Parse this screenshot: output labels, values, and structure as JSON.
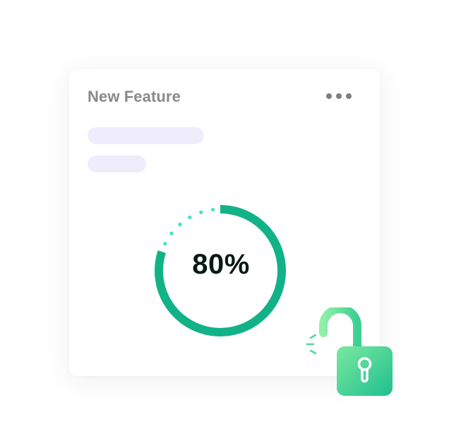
{
  "card": {
    "title": "New Feature",
    "menu_icon": "more-horizontal-icon"
  },
  "progress": {
    "value": 0.8,
    "label": "80%",
    "color": "#12b289",
    "remaining_color": "#3fe2c0"
  },
  "lock": {
    "icon": "unlocked-padlock-icon",
    "state": "unlocked",
    "gradient": [
      "#7ae9a0",
      "#1fbf8f"
    ]
  },
  "colors": {
    "placeholder": "#efedfc",
    "title": "#8a8a8a"
  }
}
